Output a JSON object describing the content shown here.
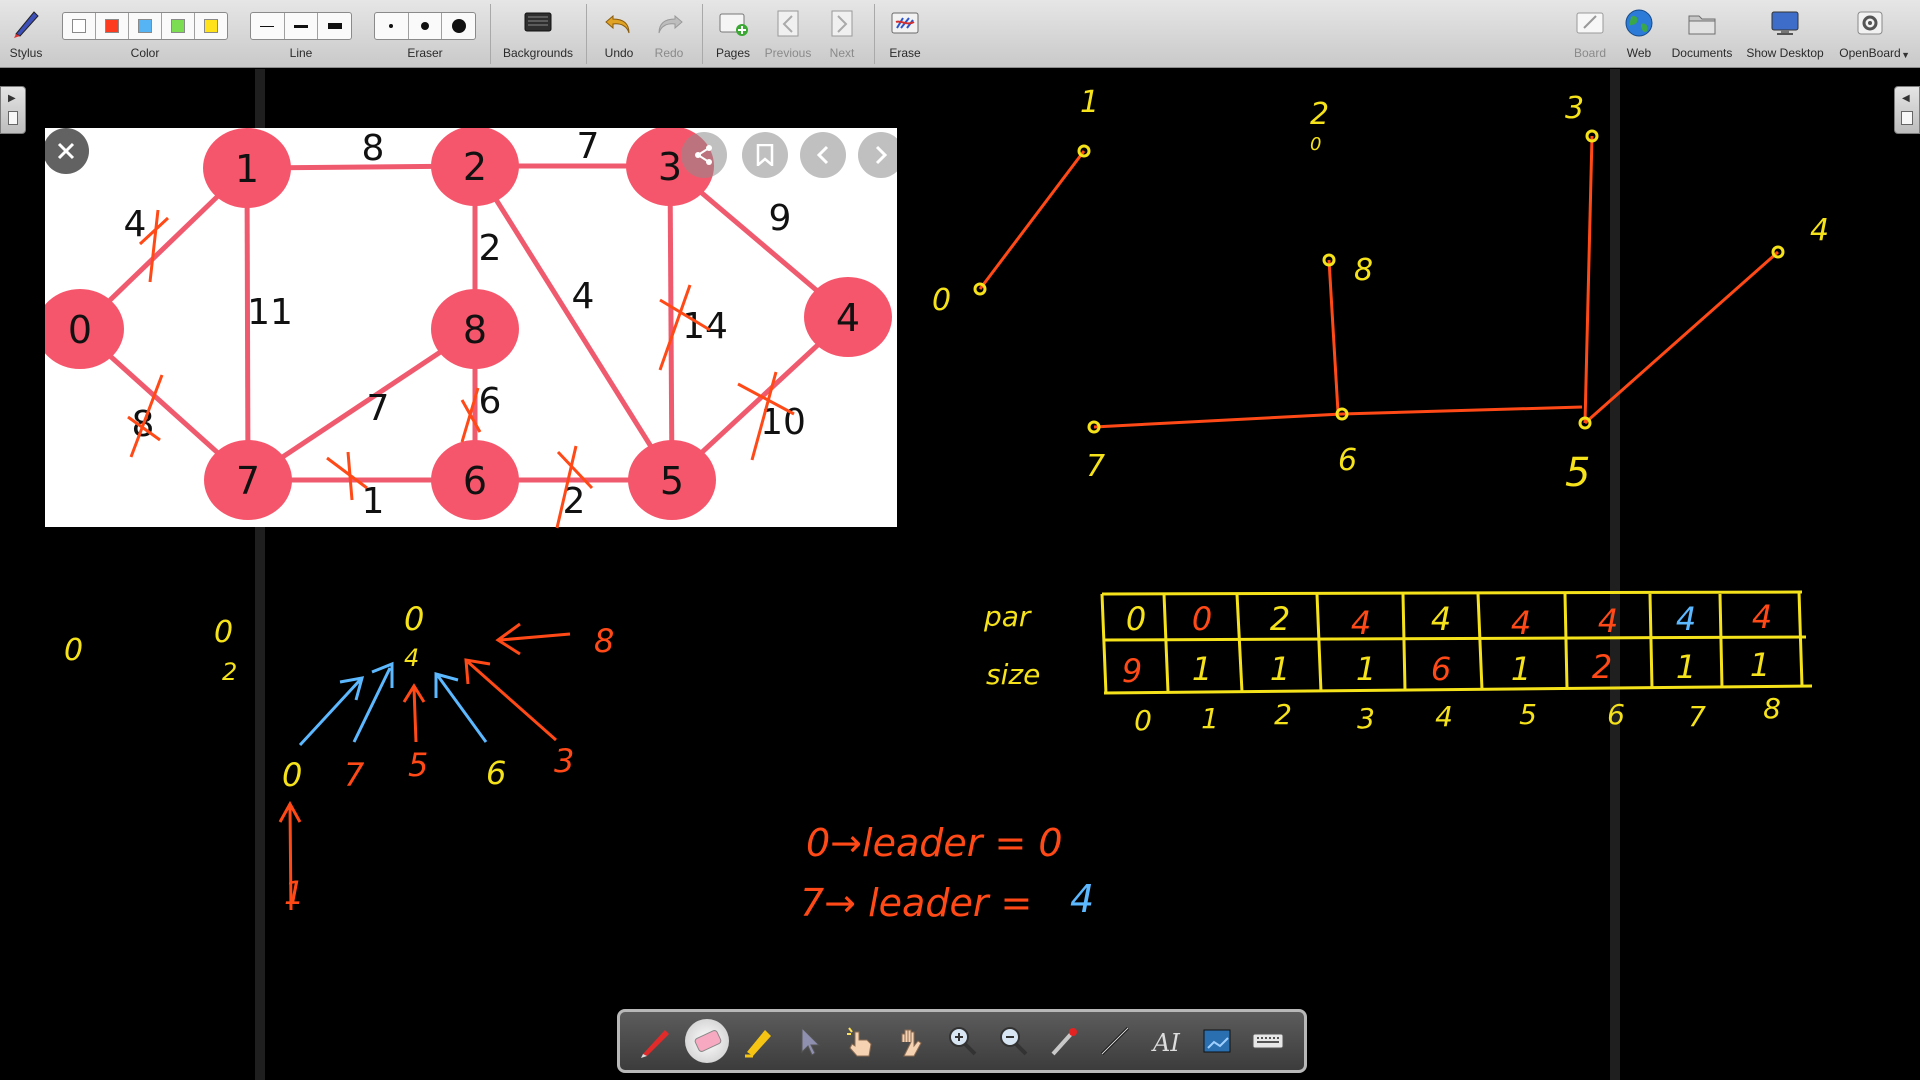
{
  "toolbar": {
    "stylus_label": "Stylus",
    "color_label": "Color",
    "line_label": "Line",
    "eraser_label": "Eraser",
    "backgrounds_label": "Backgrounds",
    "undo_label": "Undo",
    "redo_label": "Redo",
    "pages_label": "Pages",
    "previous_label": "Previous",
    "next_label": "Next",
    "erase_label": "Erase",
    "board_label": "Board",
    "web_label": "Web",
    "documents_label": "Documents",
    "show_desktop_label": "Show Desktop",
    "openboard_label": "OpenBoard",
    "colors": [
      "#ffffff",
      "#ff3b1f",
      "#56b4f5",
      "#7ddd52",
      "#ffe21a"
    ]
  },
  "graph": {
    "nodes": [
      "0",
      "1",
      "2",
      "3",
      "4",
      "5",
      "6",
      "7",
      "8"
    ],
    "edges": [
      {
        "id": "0-1",
        "weight": "4"
      },
      {
        "id": "1-2",
        "weight": "8"
      },
      {
        "id": "2-3",
        "weight": "7"
      },
      {
        "id": "3-4",
        "weight": "9"
      },
      {
        "id": "1-7",
        "weight": "11"
      },
      {
        "id": "2-8",
        "weight": "2"
      },
      {
        "id": "2-5",
        "weight": "4"
      },
      {
        "id": "3-5",
        "weight": "14"
      },
      {
        "id": "0-7",
        "weight": "8"
      },
      {
        "id": "7-8",
        "weight": "7"
      },
      {
        "id": "8-6",
        "weight": "6"
      },
      {
        "id": "4-5",
        "weight": "10"
      },
      {
        "id": "7-6",
        "weight": "1"
      },
      {
        "id": "6-5",
        "weight": "2"
      }
    ],
    "node_color": "#f6566b"
  },
  "ink": {
    "tree_labels": [
      "1",
      "0",
      "2",
      "0",
      "3",
      "8",
      "4",
      "7",
      "6",
      "5"
    ],
    "table_row_par": "par",
    "table_row_size": "size",
    "par_values": [
      "0",
      "0",
      "2",
      "4",
      "4",
      "4",
      "4",
      "4",
      "4"
    ],
    "size_values": [
      "9",
      "1",
      "1",
      "1",
      "6",
      "1",
      "2",
      "1",
      "1"
    ],
    "index_values": [
      "0",
      "1",
      "2",
      "3",
      "4",
      "5",
      "6",
      "7",
      "8"
    ],
    "left_marks": [
      "0",
      "0",
      "2"
    ],
    "union_tree": {
      "root": "0",
      "root_sub": "4",
      "children": [
        "0",
        "7",
        "5",
        "6",
        "3",
        "8"
      ],
      "leaf": "1"
    },
    "leader_line_1": "0→leader = 0",
    "leader_line_2_prefix": "7→ leader = ",
    "leader_line_2_value": "4",
    "colors": {
      "yellow": "#f5e21a",
      "orange": "#ff4a17",
      "blue": "#5cb8ff"
    }
  }
}
